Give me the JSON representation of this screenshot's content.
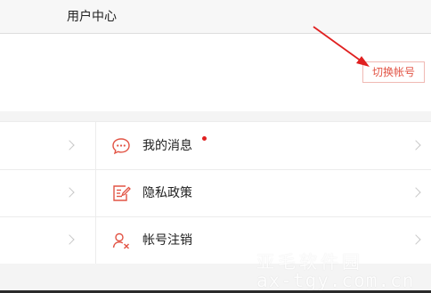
{
  "header": {
    "title": "用户中心"
  },
  "account": {
    "switch_label": "切换帐号"
  },
  "menu": {
    "items": [
      {
        "label": "我的消息",
        "icon": "chat-bubble-icon",
        "has_badge": true
      },
      {
        "label": "隐私政策",
        "icon": "document-edit-icon",
        "has_badge": false
      },
      {
        "label": "帐号注销",
        "icon": "user-remove-icon",
        "has_badge": false
      }
    ]
  },
  "watermark": {
    "line1": "亚毛软件园",
    "line2": "ax-tgy.com.cn"
  },
  "colors": {
    "accent": "#e25445",
    "badge": "#e02020",
    "annotation_arrow": "#e02020"
  }
}
